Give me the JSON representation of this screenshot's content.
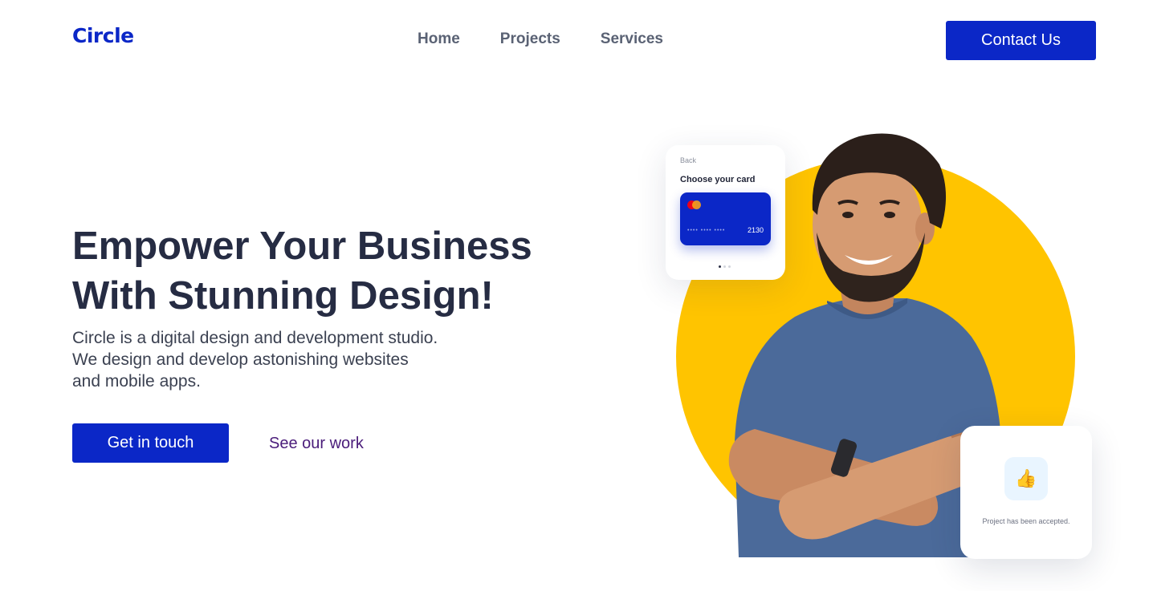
{
  "header": {
    "logo": "Circle",
    "nav": [
      {
        "label": "Home"
      },
      {
        "label": "Projects"
      },
      {
        "label": "Services"
      }
    ],
    "contact_label": "Contact Us"
  },
  "hero": {
    "headline_line1": "Empower Your Business",
    "headline_line2": "With Stunning Design!",
    "sub_line1": "Circle is a digital design and development studio.",
    "sub_line2": "We design and develop astonishing websites",
    "sub_line3": "and mobile apps.",
    "primary_cta": "Get in touch",
    "secondary_cta": "See our work"
  },
  "card_widget": {
    "back_label": "Back",
    "title": "Choose your card",
    "card_mask": "•••• •••• ••••",
    "card_last4": "2130",
    "pager_active_index": 0,
    "pager_count": 3
  },
  "accept_widget": {
    "icon": "thumbs-up-icon",
    "message": "Project has been accepted."
  },
  "colors": {
    "brand": "#0b27c7",
    "accent_yellow": "#ffc400",
    "heading": "#262c43"
  }
}
